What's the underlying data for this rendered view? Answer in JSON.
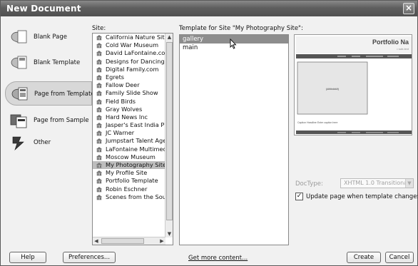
{
  "window": {
    "title": "New Document",
    "close_glyph": "×"
  },
  "categories": [
    {
      "label": "Blank Page",
      "icon": "blank-page-icon"
    },
    {
      "label": "Blank Template",
      "icon": "blank-template-icon"
    },
    {
      "label": "Page from Template",
      "icon": "page-from-template-icon",
      "selected": true
    },
    {
      "label": "Page from Sample",
      "icon": "page-from-sample-icon"
    },
    {
      "label": "Other",
      "icon": "other-icon"
    }
  ],
  "site_label": "Site:",
  "sites": [
    "California Nature Site",
    "Cold War Museum",
    "David LaFontaine.com",
    "Designs for Dancing",
    "Digital Family.com",
    "Egrets",
    "Fallow Deer",
    "Family Slide Show",
    "Field Birds",
    "Gray Wolves",
    "Hard News Inc",
    "Jasper's East India Ph",
    "JC Warner",
    "Jumpstart Talent Age",
    "LaFontaine Multimedi",
    "Moscow Museum",
    "My Photography Site",
    "My Profile Site",
    "Portfolio Template",
    "Robin Eschner",
    "Scenes from the South"
  ],
  "selected_site_index": 16,
  "template_label": "Template for Site \"My Photography Site\":",
  "templates": [
    "gallery",
    "main"
  ],
  "selected_template_index": 0,
  "preview": {
    "heading": "Portfolio Na",
    "subheading": "• sub-text",
    "image_label": "(###x###)",
    "caption": "Caption Headline  Enter caption here"
  },
  "doctype_label": "DocType:",
  "doctype_value": "XHTML 1.0 Transitional",
  "update_label": "Update page when template changes",
  "update_checked": true,
  "buttons": {
    "help": "Help",
    "preferences": "Preferences...",
    "get_more": "Get more content...",
    "create": "Create",
    "cancel": "Cancel"
  }
}
